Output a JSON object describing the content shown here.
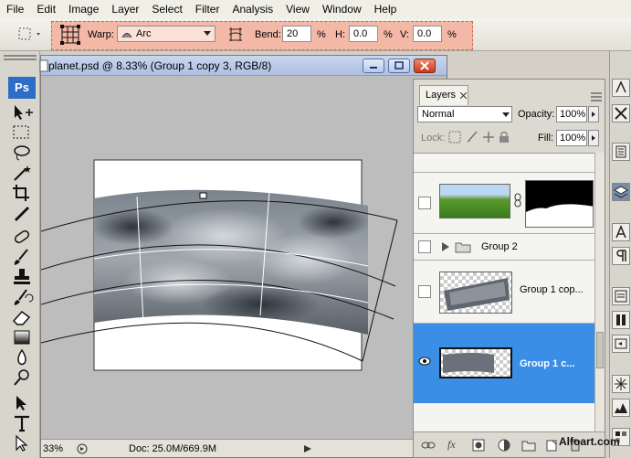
{
  "menu": [
    "File",
    "Edit",
    "Image",
    "Layer",
    "Select",
    "Filter",
    "Analysis",
    "View",
    "Window",
    "Help"
  ],
  "options": {
    "warp_label": "Warp:",
    "warp_style": "Arc",
    "bend_label": "Bend:",
    "bend_value": "20",
    "bend_unit": "%",
    "h_label": "H:",
    "h_value": "0.0",
    "h_unit": "%",
    "v_label": "V:",
    "v_value": "0.0",
    "v_unit": "%"
  },
  "app_logo": "Ps",
  "document": {
    "title": "planet.psd @ 8.33% (Group 1 copy 3, RGB/8)",
    "zoom": "33%",
    "doc_info": "Doc: 25.0M/669.9M"
  },
  "layers_panel": {
    "tab_label": "Layers",
    "blend_mode": "Normal",
    "opacity_label": "Opacity:",
    "opacity_value": "100%",
    "lock_label": "Lock:",
    "fill_label": "Fill:",
    "fill_value": "100%",
    "layers": [
      {
        "name": "",
        "type": "masked-layer",
        "visible": false,
        "selected": false
      },
      {
        "name": "Group 2",
        "type": "group",
        "visible": false,
        "selected": false
      },
      {
        "name": "Group 1 cop...",
        "type": "layer",
        "visible": false,
        "selected": false
      },
      {
        "name": "Group 1 c...",
        "type": "layer",
        "visible": true,
        "selected": true
      }
    ]
  },
  "watermark": "Alfoart.com",
  "colors": {
    "selection": "#3a8ee6",
    "warp_highlight": "#f4b8a6",
    "ps_logo": "#2b6dc7"
  },
  "icons": [
    "warp-grid-icon",
    "arc-style-icon",
    "warp-orientation-icon",
    "move-tool-icon",
    "eye-icon",
    "link-icon",
    "folder-icon"
  ]
}
